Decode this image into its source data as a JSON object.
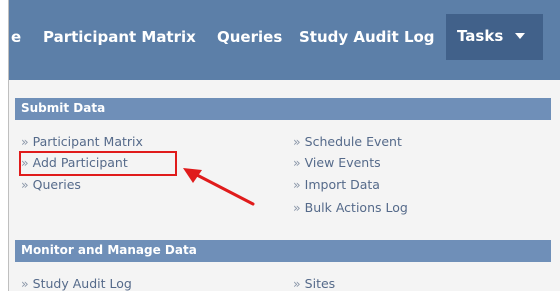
{
  "navbar": {
    "cut_item": "e",
    "items": [
      {
        "label": "Participant Matrix"
      },
      {
        "label": "Queries"
      },
      {
        "label": "Study Audit Log"
      }
    ],
    "tasks": {
      "label": "Tasks"
    }
  },
  "menu": {
    "bullet": "»",
    "submit_data": {
      "header": "Submit Data",
      "left": [
        "Participant Matrix",
        "Add Participant",
        "Queries"
      ],
      "right": [
        "Schedule Event",
        "View Events",
        "Import Data",
        "Bulk Actions Log"
      ]
    },
    "monitor": {
      "header": "Monitor and Manage Data",
      "left": [
        "Study Audit Log"
      ],
      "right": [
        "Sites"
      ]
    }
  },
  "annotation": {
    "highlight_color": "#e01b1b"
  },
  "colors": {
    "nav_bg": "#5c7fa8",
    "tasks_bg": "#41618a",
    "section_header_bg": "#6f8fb8",
    "link": "#556a8a"
  },
  "icons": {
    "tasks_caret": "caret-down-icon",
    "annotation_arrow": "red-arrow-icon"
  }
}
